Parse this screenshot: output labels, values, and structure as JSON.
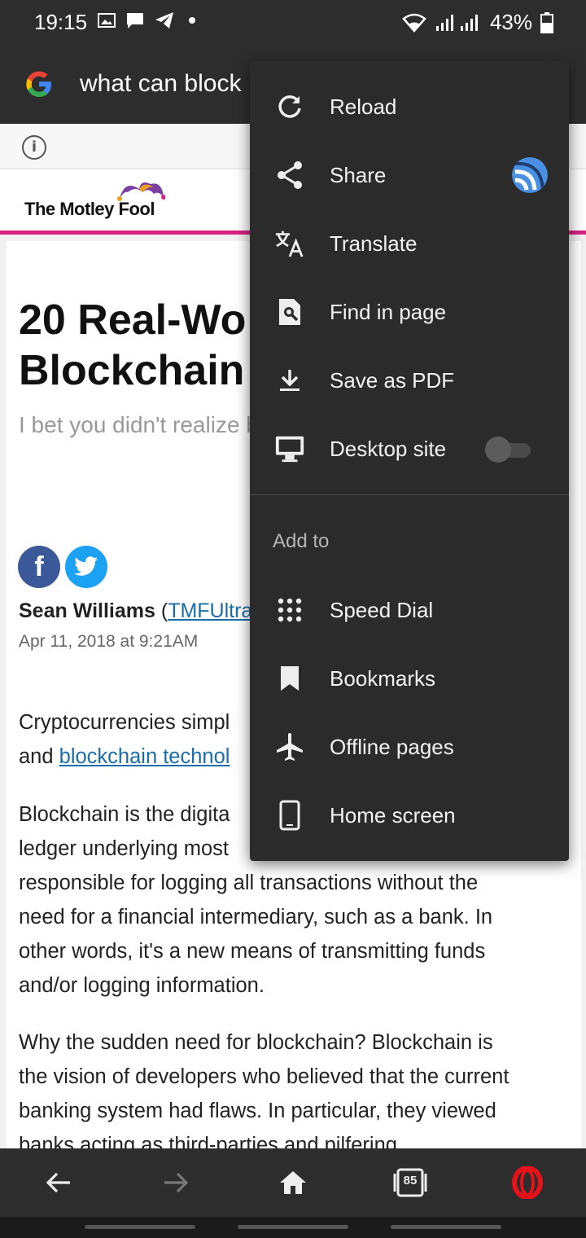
{
  "status_bar": {
    "time": "19:15",
    "battery": "43%"
  },
  "address_bar": {
    "url_text": "what can block"
  },
  "page": {
    "site_name": "The Motley Fool",
    "headline": "20 Real-Wo\nBlockchain",
    "subhead": "I bet you didn't realize b",
    "author_name": "Sean Williams",
    "author_open": "(",
    "author_handle": "TMFUltraL",
    "date": "Apr 11, 2018 at 9:21AM",
    "p1_line1": "Cryptocurrencies simpl",
    "p1_line2_pre": "and ",
    "p1_link": "blockchain technol",
    "p2_lines": [
      "Blockchain is the digita",
      "ledger underlying most",
      "responsible for logging all transactions without the",
      "need for a financial intermediary, such as a bank. In",
      "other words, it's a new means of transmitting funds",
      "and/or logging information."
    ],
    "p3_lines": [
      "Why the sudden need for blockchain? Blockchain is",
      "the vision of developers who believed that the current",
      "banking system had flaws. In particular, they viewed",
      "banks acting as third-parties and pilfering"
    ]
  },
  "menu": {
    "items": [
      {
        "label": "Reload",
        "icon": "reload-icon"
      },
      {
        "label": "Share",
        "icon": "share-icon"
      },
      {
        "label": "Translate",
        "icon": "translate-icon"
      },
      {
        "label": "Find in page",
        "icon": "find-in-page-icon"
      },
      {
        "label": "Save as PDF",
        "icon": "download-icon"
      },
      {
        "label": "Desktop site",
        "icon": "desktop-icon"
      }
    ],
    "section_label": "Add to",
    "add_items": [
      {
        "label": "Speed Dial",
        "icon": "speed-dial-icon"
      },
      {
        "label": "Bookmarks",
        "icon": "bookmark-icon"
      },
      {
        "label": "Offline pages",
        "icon": "airplane-icon"
      },
      {
        "label": "Home screen",
        "icon": "phone-icon"
      }
    ],
    "desktop_site_enabled": false
  },
  "bottom_nav": {
    "tabs_count": "85"
  },
  "colors": {
    "accent_pink": "#d6237f",
    "link_blue": "#1a6da8",
    "opera_red": "#e3121b",
    "facebook": "#3b5998",
    "twitter": "#1da1f2"
  }
}
